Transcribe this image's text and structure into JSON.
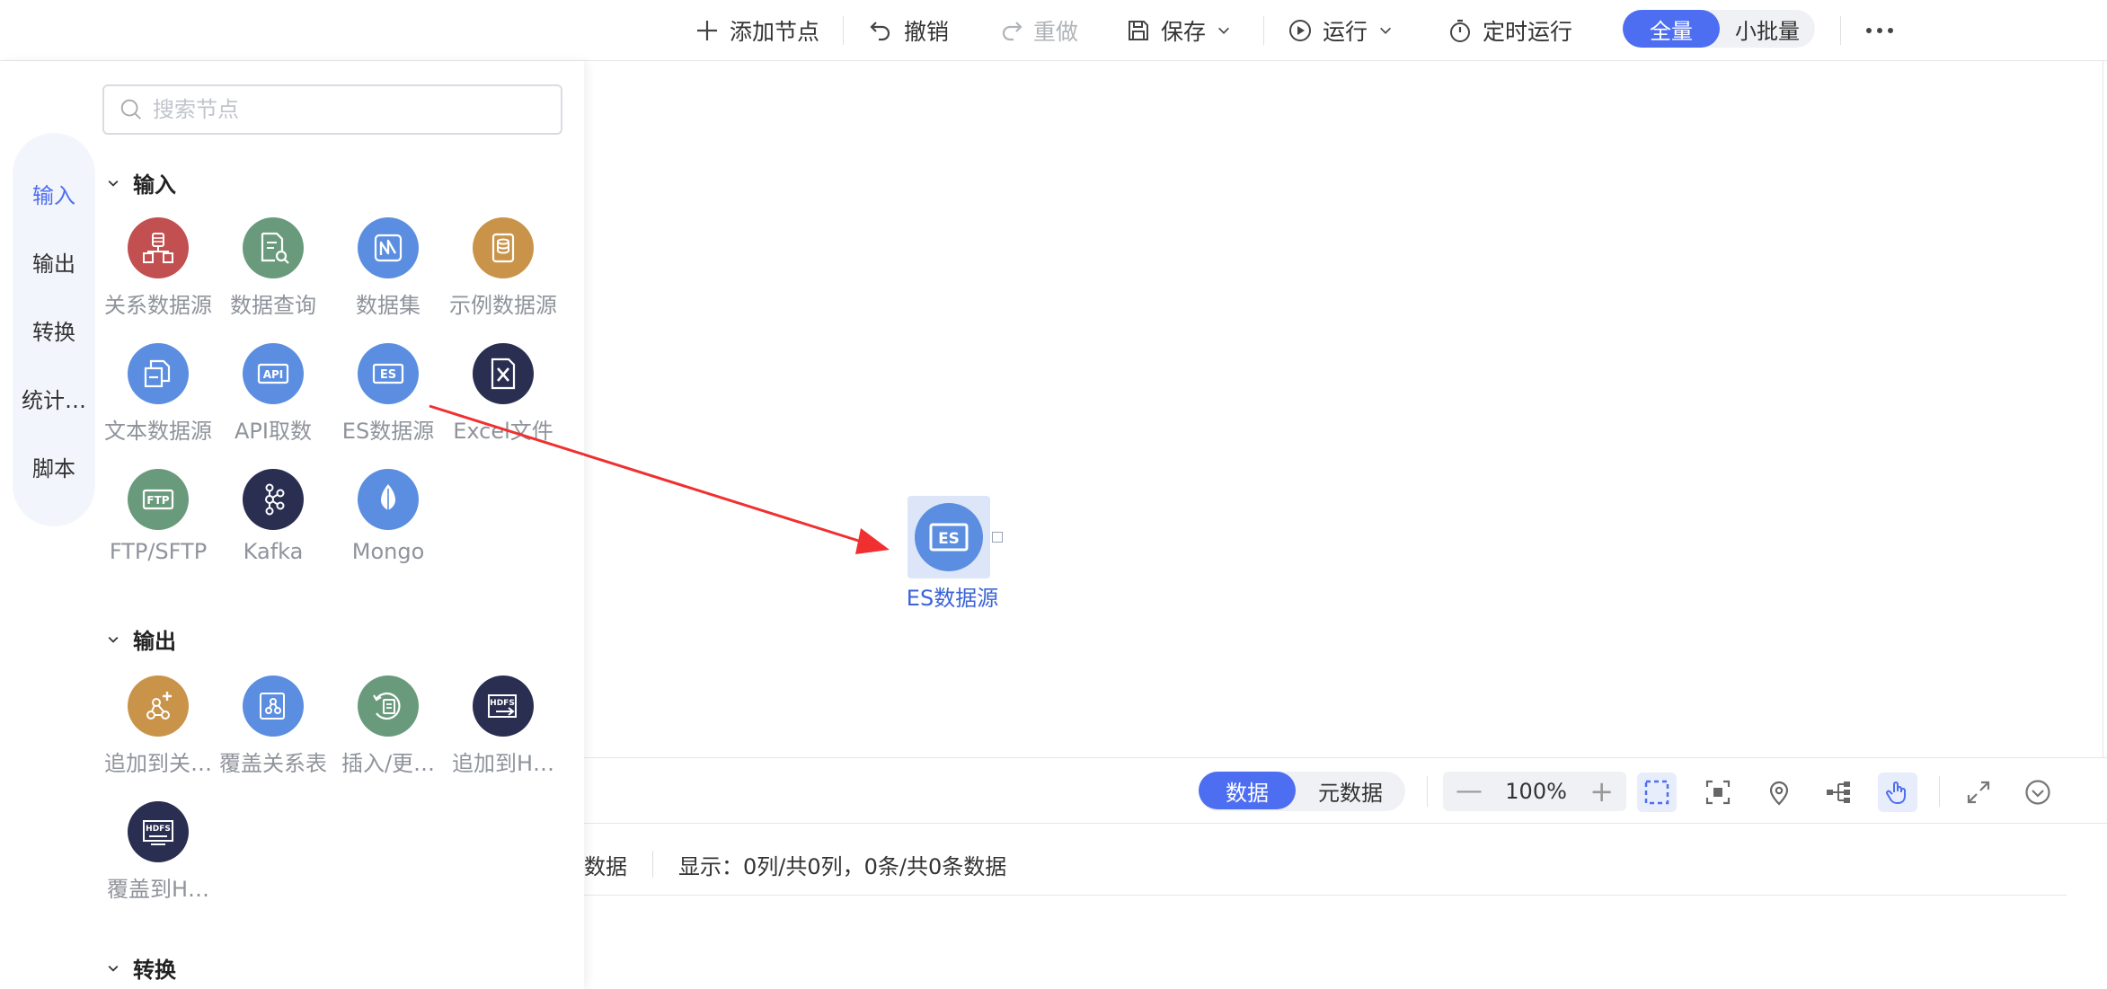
{
  "toolbar": {
    "add_node": "添加节点",
    "undo": "撤销",
    "redo": "重做",
    "save": "保存",
    "run": "运行",
    "scheduled_run": "定时运行",
    "mode_full": "全量",
    "mode_batch": "小批量"
  },
  "tabs": [
    "输入",
    "输出",
    "转换",
    "统计…",
    "脚本"
  ],
  "search": {
    "placeholder": "搜索节点"
  },
  "sections": {
    "input": {
      "title": "输入",
      "nodes": [
        "关系数据源",
        "数据查询",
        "数据集",
        "示例数据源",
        "文本数据源",
        "API取数",
        "ES数据源",
        "Excel文件",
        "FTP/SFTP",
        "Kafka",
        "Mongo"
      ]
    },
    "output": {
      "title": "输出",
      "nodes": [
        "追加到关…",
        "覆盖关系表",
        "插入/更…",
        "追加到H…",
        "覆盖到H…"
      ]
    },
    "transform": {
      "title": "转换"
    }
  },
  "icons": {
    "relational": "database-icon",
    "query": "search-document-icon",
    "dataset": "dataset-icon",
    "sample": "sample-db-icon",
    "text": "text-file-icon",
    "api": "api-icon",
    "es": "es-icon",
    "excel": "excel-icon",
    "ftp": "ftp-icon",
    "kafka": "kafka-icon",
    "mongo": "mongo-leaf-icon",
    "hdfs": "hdfs-icon"
  },
  "colors": {
    "accent": "#4e6ef2",
    "arrow": "#f03030",
    "red": "#c25050",
    "green": "#6a9a7c",
    "blue": "#5b8ee0",
    "gold": "#c9944a",
    "navy": "#2a2f52"
  },
  "canvas": {
    "node_label": "ES数据源",
    "node_icon": "ES"
  },
  "bottom": {
    "tab_data": "数据",
    "tab_meta": "元数据",
    "zoom": "100%",
    "info_left": "数据",
    "info_display": "显示：0列/共0列，0条/共0条数据"
  }
}
